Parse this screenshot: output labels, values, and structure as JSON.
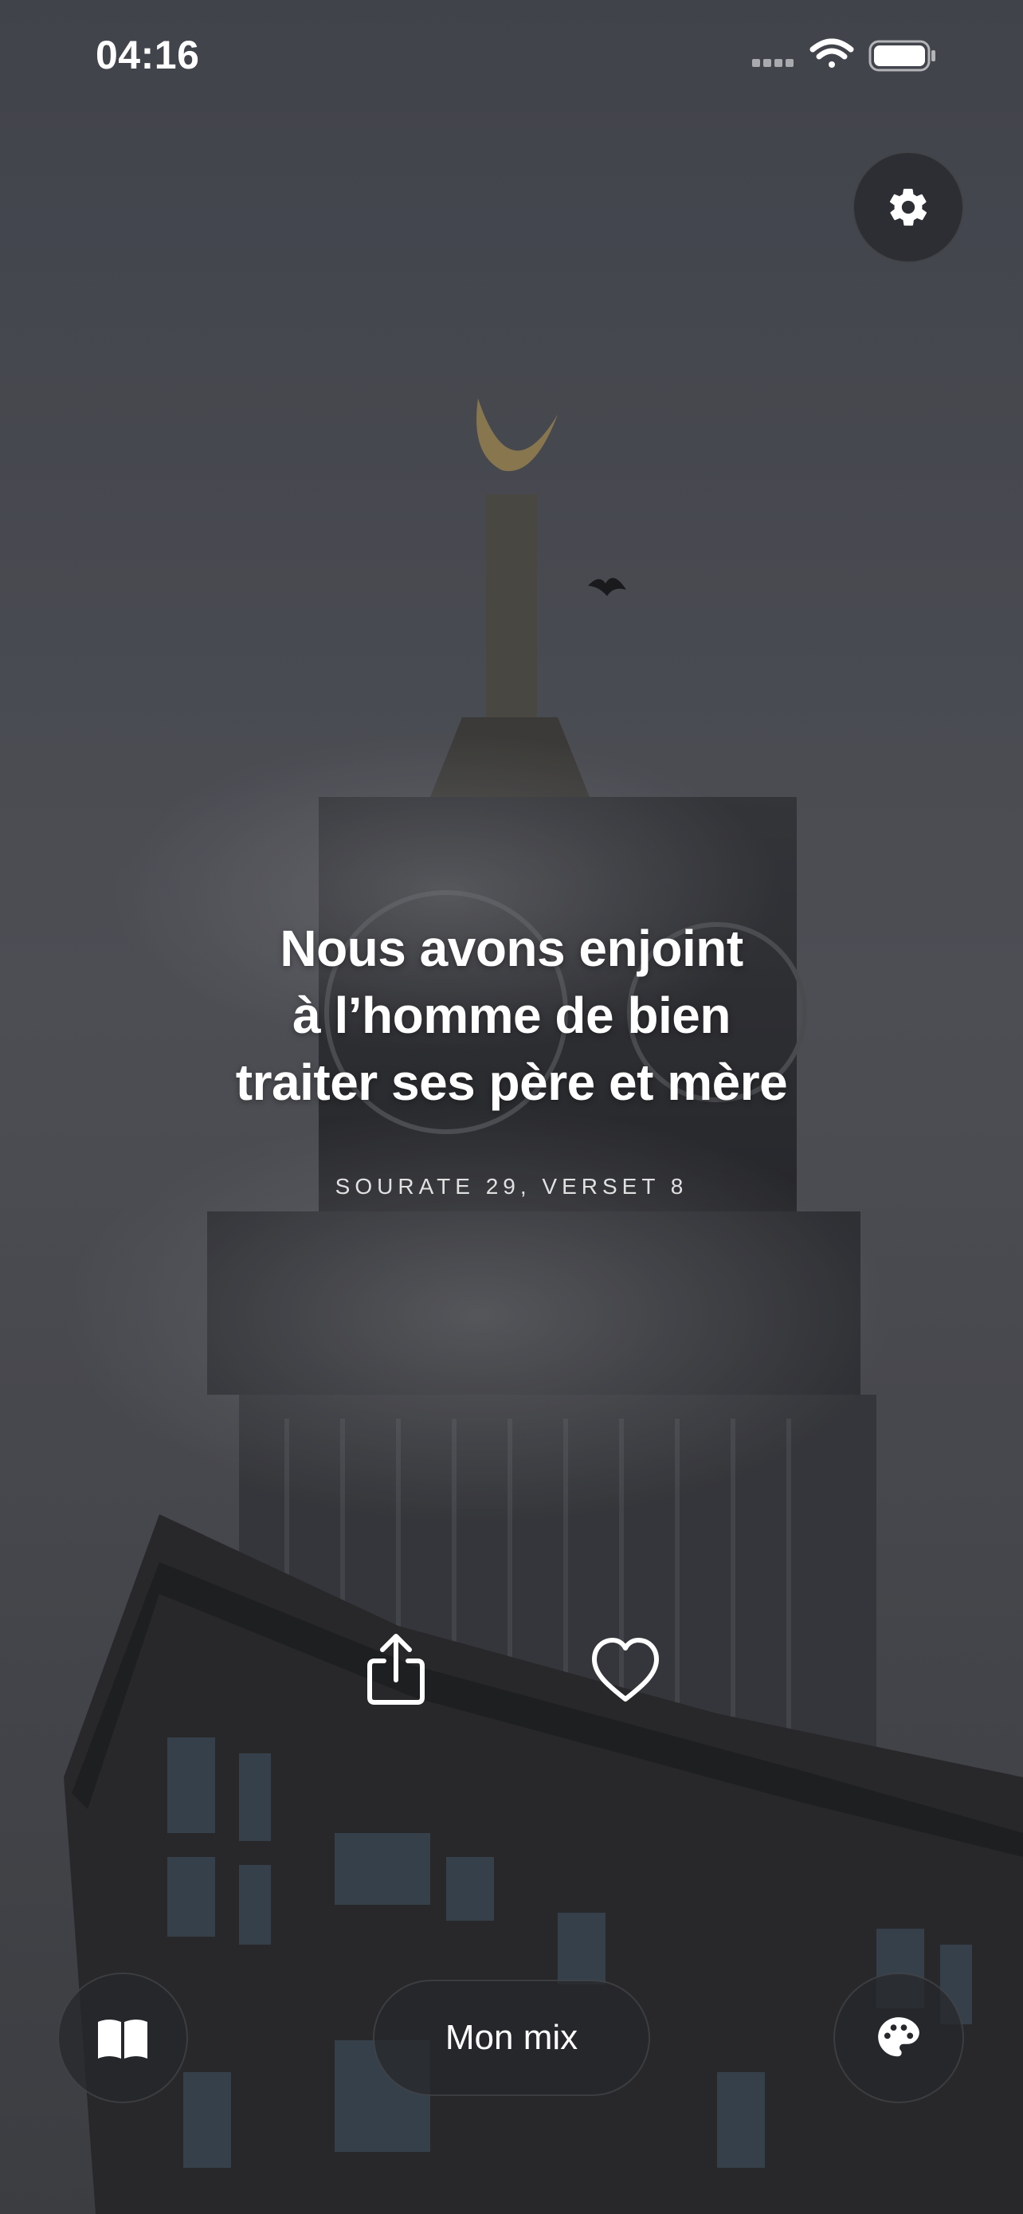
{
  "status_bar": {
    "time": "04:16"
  },
  "verse": {
    "lines": [
      "Nous avons enjoint",
      "à l’homme de bien",
      "traiter ses père et mère"
    ],
    "reference": "SOURATE 29, VERSET 8"
  },
  "actions": {
    "share_icon": "share-icon",
    "like_icon": "heart-icon"
  },
  "bottom_bar": {
    "library_icon": "book-icon",
    "mix_label": "Mon mix",
    "theme_icon": "palette-icon"
  },
  "settings_icon": "gear-icon",
  "colors": {
    "text": "#ffffff",
    "button_bg": "#26282c"
  }
}
